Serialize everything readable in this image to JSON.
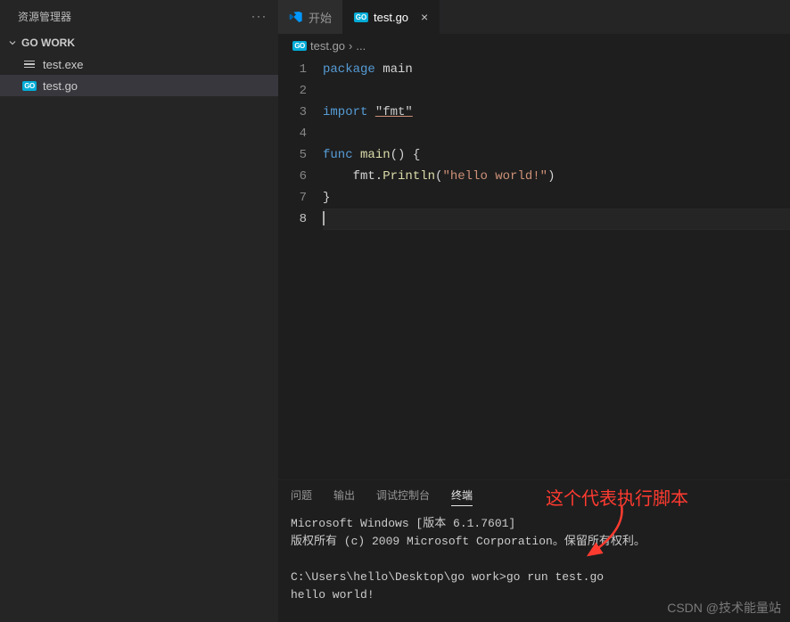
{
  "sidebar": {
    "title": "资源管理器",
    "folder": "GO WORK",
    "items": [
      {
        "name": "test.exe",
        "icon": "lines"
      },
      {
        "name": "test.go",
        "icon": "go",
        "selected": true
      }
    ]
  },
  "tabs": [
    {
      "label": "开始",
      "icon": "vscode",
      "active": false
    },
    {
      "label": "test.go",
      "icon": "go",
      "active": true,
      "closable": true
    }
  ],
  "breadcrumb": {
    "file": "test.go",
    "sep": "›",
    "more": "..."
  },
  "editor": {
    "lines": [
      {
        "n": 1,
        "tokens": [
          [
            "kw",
            "package "
          ],
          [
            "plain",
            "main"
          ]
        ]
      },
      {
        "n": 2,
        "tokens": []
      },
      {
        "n": 3,
        "tokens": [
          [
            "kw",
            "import "
          ],
          [
            "str-u",
            "\"fmt\""
          ]
        ]
      },
      {
        "n": 4,
        "tokens": []
      },
      {
        "n": 5,
        "tokens": [
          [
            "kw",
            "func "
          ],
          [
            "fn",
            "main"
          ],
          [
            "plain",
            "() {"
          ]
        ]
      },
      {
        "n": 6,
        "tokens": [
          [
            "plain",
            "    fmt."
          ],
          [
            "fn",
            "Println"
          ],
          [
            "plain",
            "("
          ],
          [
            "str",
            "\"hello world!\""
          ],
          [
            "plain",
            ")"
          ]
        ]
      },
      {
        "n": 7,
        "tokens": [
          [
            "plain",
            "}"
          ]
        ]
      },
      {
        "n": 8,
        "tokens": [],
        "current": true
      }
    ]
  },
  "terminal": {
    "tabs": [
      {
        "label": "问题",
        "active": false
      },
      {
        "label": "输出",
        "active": false
      },
      {
        "label": "调试控制台",
        "active": false
      },
      {
        "label": "终端",
        "active": true
      }
    ],
    "lines": [
      "Microsoft Windows [版本 6.1.7601]",
      "版权所有 (c) 2009 Microsoft Corporation。保留所有权利。",
      "",
      "C:\\Users\\hello\\Desktop\\go work>go run test.go",
      "hello world!"
    ]
  },
  "annotation": {
    "text": "这个代表执行脚本"
  },
  "watermark": "CSDN @技术能量站"
}
